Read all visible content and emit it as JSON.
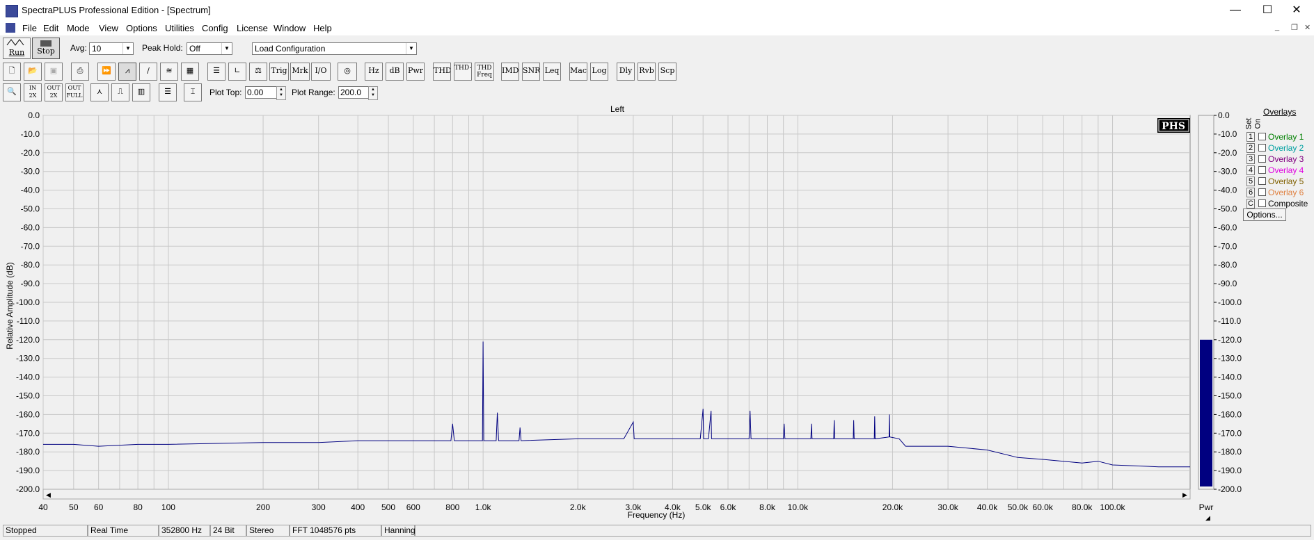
{
  "window": {
    "title": "SpectraPLUS Professional Edition - [Spectrum]",
    "minimize": "—",
    "maximize": "☐",
    "close": "✕"
  },
  "menu": [
    "File",
    "Edit",
    "Mode",
    "View",
    "Options",
    "Utilities",
    "Config",
    "License",
    "Window",
    "Help"
  ],
  "toolbar1": {
    "run_label": "Run",
    "stop_label": "Stop",
    "avg_label": "Avg:",
    "avg_value": "10",
    "peak_label": "Peak Hold:",
    "peak_value": "Off",
    "config_value": "Load Configuration"
  },
  "toolbar2": [
    "Trig",
    "Mrk",
    "I/O",
    "Hz",
    "dB",
    "Pwr",
    "THD",
    "THD+N",
    "THD Freq",
    "IMD",
    "SNR",
    "Leq",
    "Mac",
    "Log",
    "Dly",
    "Rvb",
    "Scp"
  ],
  "toolbar3": {
    "plot_top_label": "Plot Top:",
    "plot_top_value": "0.00",
    "plot_range_label": "Plot Range:",
    "plot_range_value": "200.0"
  },
  "chart_data": {
    "type": "line",
    "title": "Left",
    "xlabel": "Frequency (Hz)",
    "ylabel": "Relative Amplitude (dB)",
    "x_scale": "log",
    "xlim": [
      40,
      176400
    ],
    "ylim": [
      -200,
      0
    ],
    "grid": true,
    "y_ticks": [
      "0.0",
      "-10.0",
      "-20.0",
      "-30.0",
      "-40.0",
      "-50.0",
      "-60.0",
      "-70.0",
      "-80.0",
      "-90.0",
      "-100.0",
      "-110.0",
      "-120.0",
      "-130.0",
      "-140.0",
      "-150.0",
      "-160.0",
      "-170.0",
      "-180.0",
      "-190.0",
      "-200.0"
    ],
    "x_ticks": [
      {
        "v": 40,
        "t": "40"
      },
      {
        "v": 50,
        "t": "50"
      },
      {
        "v": 60,
        "t": "60"
      },
      {
        "v": 80,
        "t": "80"
      },
      {
        "v": 100,
        "t": "100"
      },
      {
        "v": 200,
        "t": "200"
      },
      {
        "v": 300,
        "t": "300"
      },
      {
        "v": 400,
        "t": "400"
      },
      {
        "v": 500,
        "t": "500"
      },
      {
        "v": 600,
        "t": "600"
      },
      {
        "v": 800,
        "t": "800"
      },
      {
        "v": 1000,
        "t": "1.0k"
      },
      {
        "v": 2000,
        "t": "2.0k"
      },
      {
        "v": 3000,
        "t": "3.0k"
      },
      {
        "v": 4000,
        "t": "4.0k"
      },
      {
        "v": 5000,
        "t": "5.0k"
      },
      {
        "v": 6000,
        "t": "6.0k"
      },
      {
        "v": 8000,
        "t": "8.0k"
      },
      {
        "v": 10000,
        "t": "10.0k"
      },
      {
        "v": 20000,
        "t": "20.0k"
      },
      {
        "v": 30000,
        "t": "30.0k"
      },
      {
        "v": 40000,
        "t": "40.0k"
      },
      {
        "v": 50000,
        "t": "50.0k"
      },
      {
        "v": 60000,
        "t": "60.0k"
      },
      {
        "v": 80000,
        "t": "80.0k"
      },
      {
        "v": 100000,
        "t": "100.0k"
      }
    ],
    "series": [
      {
        "color": "#000080",
        "points": [
          [
            40,
            -176
          ],
          [
            50,
            -176
          ],
          [
            60,
            -177
          ],
          [
            80,
            -176
          ],
          [
            100,
            -176
          ],
          [
            200,
            -175
          ],
          [
            300,
            -175
          ],
          [
            400,
            -174
          ],
          [
            500,
            -174
          ],
          [
            600,
            -174
          ],
          [
            790,
            -174
          ],
          [
            800,
            -165
          ],
          [
            810,
            -174
          ],
          [
            995,
            -174
          ],
          [
            1000,
            -121
          ],
          [
            1005,
            -174
          ],
          [
            1100,
            -174
          ],
          [
            1110,
            -159
          ],
          [
            1120,
            -174
          ],
          [
            1300,
            -174
          ],
          [
            1310,
            -167
          ],
          [
            1320,
            -174
          ],
          [
            2000,
            -173
          ],
          [
            2800,
            -173
          ],
          [
            3000,
            -164
          ],
          [
            3020,
            -173
          ],
          [
            4000,
            -173
          ],
          [
            4900,
            -173
          ],
          [
            5000,
            -157
          ],
          [
            5020,
            -173
          ],
          [
            5200,
            -173
          ],
          [
            5300,
            -158
          ],
          [
            5320,
            -173
          ],
          [
            7000,
            -173
          ],
          [
            7050,
            -158
          ],
          [
            7100,
            -173
          ],
          [
            9000,
            -173
          ],
          [
            9050,
            -165
          ],
          [
            9100,
            -173
          ],
          [
            11000,
            -173
          ],
          [
            11050,
            -165
          ],
          [
            11100,
            -173
          ],
          [
            13000,
            -173
          ],
          [
            13050,
            -163
          ],
          [
            13100,
            -173
          ],
          [
            15000,
            -173
          ],
          [
            15050,
            -163
          ],
          [
            15100,
            -173
          ],
          [
            17500,
            -173
          ],
          [
            17550,
            -161
          ],
          [
            17600,
            -173
          ],
          [
            19500,
            -172
          ],
          [
            19550,
            -160
          ],
          [
            19600,
            -172
          ],
          [
            21000,
            -173
          ],
          [
            22000,
            -177
          ],
          [
            30000,
            -177
          ],
          [
            40000,
            -179
          ],
          [
            50000,
            -183
          ],
          [
            60000,
            -184
          ],
          [
            80000,
            -186
          ],
          [
            90000,
            -185
          ],
          [
            100000,
            -187
          ],
          [
            140000,
            -188
          ],
          [
            176400,
            -188
          ]
        ]
      }
    ],
    "level_meter": {
      "label": "Pwr",
      "value": -120.0,
      "color": "#000080"
    }
  },
  "overlays": {
    "title": "Overlays",
    "set_label": "Set",
    "on_label": "On",
    "items": [
      {
        "num": "1",
        "label": "Overlay 1",
        "color": "#008000"
      },
      {
        "num": "2",
        "label": "Overlay 2",
        "color": "#00a0a0"
      },
      {
        "num": "3",
        "label": "Overlay 3",
        "color": "#800080"
      },
      {
        "num": "4",
        "label": "Overlay 4",
        "color": "#e000e0"
      },
      {
        "num": "5",
        "label": "Overlay 5",
        "color": "#806000"
      },
      {
        "num": "6",
        "label": "Overlay 6",
        "color": "#e08040"
      },
      {
        "num": "C",
        "label": "Composite",
        "color": "#000000"
      }
    ],
    "options_label": "Options..."
  },
  "status": [
    "Stopped",
    "Real Time",
    "352800 Hz",
    "24 Bit",
    "Stereo",
    "FFT 1048576 pts",
    "Hanning"
  ]
}
